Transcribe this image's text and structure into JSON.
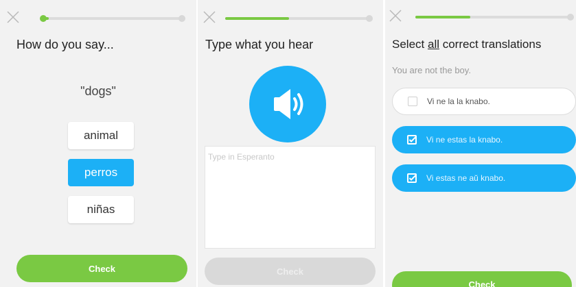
{
  "screens": [
    {
      "title": "How do you say...",
      "word": "\"dogs\"",
      "choices": [
        "animal",
        "perros",
        "niñas"
      ],
      "selected_choice": "perros",
      "check_label": "Check",
      "progress": 0.05
    },
    {
      "title": "Type what you hear",
      "input_placeholder": "Type in Esperanto",
      "check_label": "Check",
      "check_enabled": false,
      "progress": 0.44
    },
    {
      "title_before": "Select ",
      "title_emphasis": "all",
      "title_after": " correct translations",
      "prompt": "You are not the boy.",
      "options": [
        {
          "text": "Vi ne la la knabo.",
          "checked": false
        },
        {
          "text": "Vi ne estas la knabo.",
          "checked": true
        },
        {
          "text": "Vi estas ne aŭ knabo.",
          "checked": true
        }
      ],
      "check_label": "Check",
      "progress": 0.35
    }
  ],
  "icons": {
    "close": "close-icon",
    "speaker": "speaker-icon",
    "checkbox": "checkbox-icon"
  },
  "colors": {
    "accent_blue": "#1cb0f6",
    "accent_green": "#7ac943",
    "disabled_grey": "#d9d9d9"
  }
}
